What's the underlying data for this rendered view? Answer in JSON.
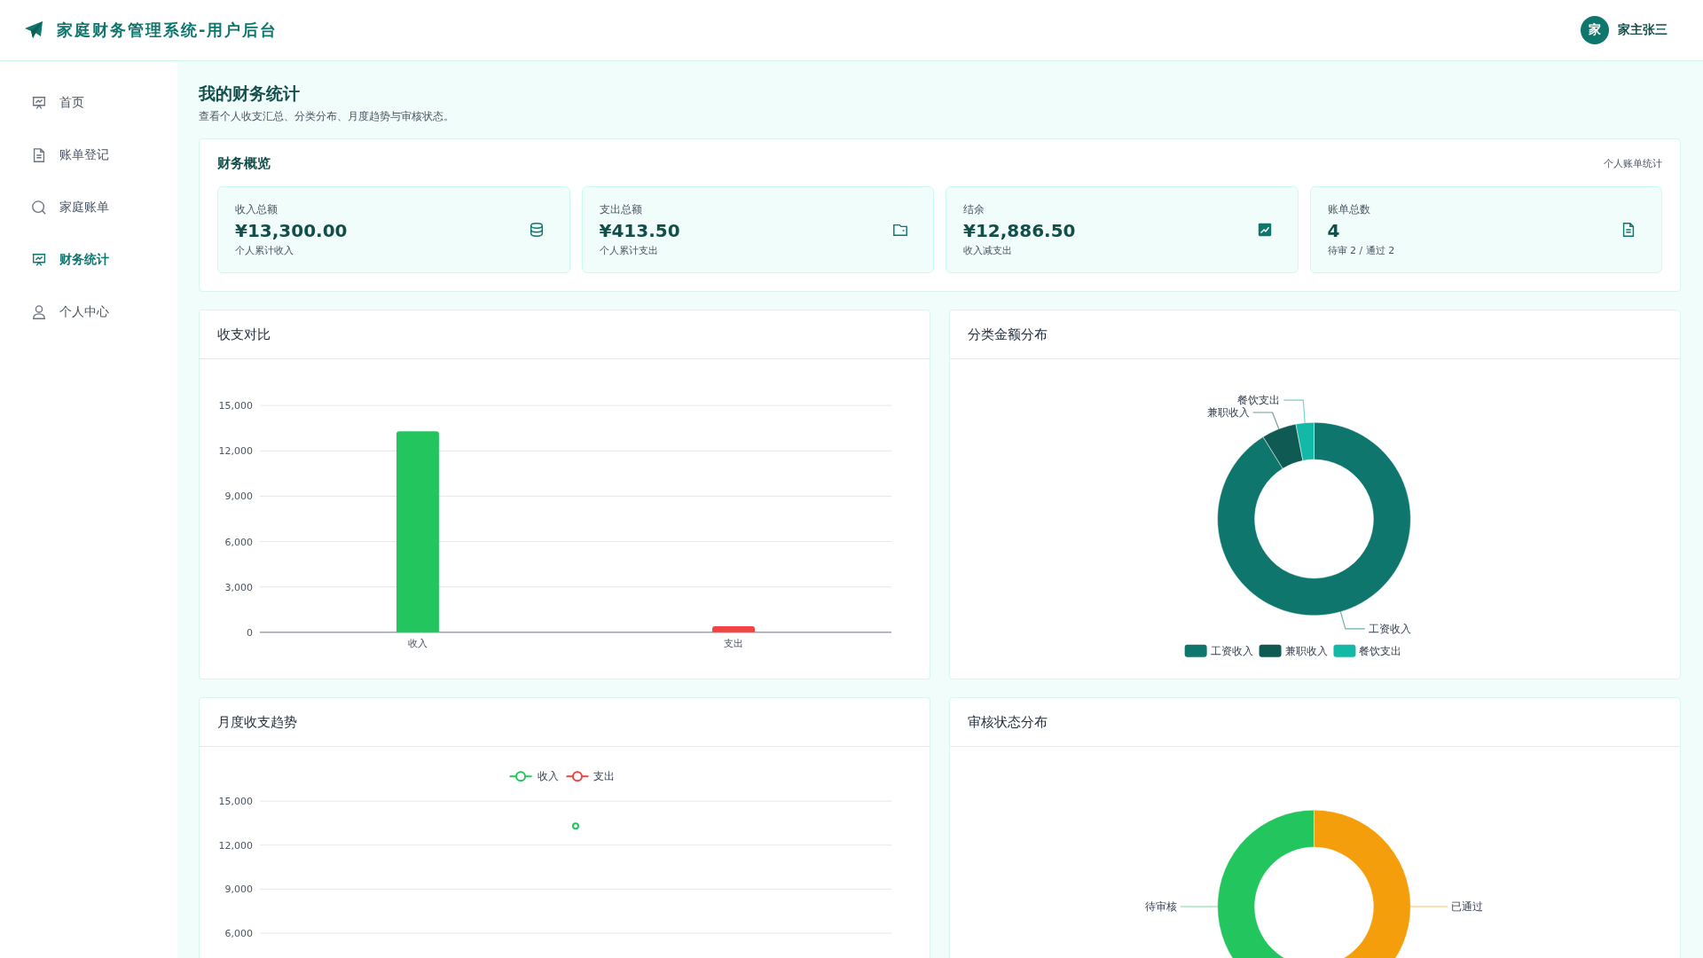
{
  "header": {
    "title": "家庭财务管理系统-用户后台",
    "user": {
      "avatar_text": "家",
      "name": "家主张三"
    }
  },
  "sidebar": {
    "items": [
      {
        "label": "首页",
        "kind": "board",
        "selected": false
      },
      {
        "label": "账单登记",
        "kind": "document",
        "selected": false
      },
      {
        "label": "家庭账单",
        "kind": "search",
        "selected": false
      },
      {
        "label": "财务统计",
        "kind": "board",
        "selected": true
      },
      {
        "label": "个人中心",
        "kind": "user",
        "selected": false
      }
    ]
  },
  "page": {
    "title": "我的财务统计",
    "subtitle": "查看个人收支汇总、分类分布、月度趋势与审核状态。"
  },
  "overview": {
    "title": "财务概览",
    "note": "个人账单统计",
    "cards": [
      {
        "label": "收入总额",
        "value": "¥13,300.00",
        "note": "个人累计收入",
        "kind": "coins"
      },
      {
        "label": "支出总额",
        "value": "¥413.50",
        "note": "个人累计支出",
        "kind": "wallet"
      },
      {
        "label": "结余",
        "value": "¥12,886.50",
        "note": "收入减支出",
        "kind": "chart"
      },
      {
        "label": "账单总数",
        "value": "4",
        "note": "待审 2 / 通过 2",
        "kind": "document"
      }
    ]
  },
  "panels": [
    {
      "title": "收支对比",
      "chart_data": {
        "type": "bar",
        "categories": [
          "收入",
          "支出"
        ],
        "values": [
          13300,
          400
        ],
        "colors": [
          "#22c55e",
          "#ef4444"
        ],
        "grid": true,
        "ylim": [
          0,
          15000
        ],
        "yticks": [
          {
            "value": 0,
            "label": "0"
          },
          {
            "value": 3000,
            "label": "3,000"
          },
          {
            "value": 6000,
            "label": "6,000"
          },
          {
            "value": 9000,
            "label": "9,000"
          },
          {
            "value": 12000,
            "label": "12,000"
          },
          {
            "value": 15000,
            "label": "15,000"
          }
        ]
      }
    },
    {
      "title": "分类金额分布",
      "chart_data": {
        "type": "donut",
        "categories": [
          "工资收入",
          "兼职收入",
          "餐饮支出"
        ],
        "values": [
          91.15,
          5.83,
          3.02
        ],
        "colors": [
          "#0f766e",
          "#0f5a52",
          "#14b8a6"
        ],
        "legend": true
      }
    },
    {
      "title": "月度收支趋势",
      "chart_data": {
        "type": "line",
        "series": [
          {
            "name": "收入",
            "color": "#22c55e",
            "marker": true,
            "values": [
              13300
            ]
          },
          {
            "name": "支出",
            "color": "#ef4444",
            "marker": true,
            "values": [
              null
            ]
          }
        ],
        "grid": true,
        "ylim": [
          6000,
          15000
        ],
        "yticks": [
          {
            "value": 6000,
            "label": "6,000"
          },
          {
            "value": 9000,
            "label": "9,000"
          },
          {
            "value": 12000,
            "label": "12,000"
          },
          {
            "value": 15000,
            "label": "15,000"
          }
        ]
      }
    },
    {
      "title": "审核状态分布",
      "chart_data": {
        "type": "donut",
        "categories": [
          "已通过",
          "待审核"
        ],
        "values": [
          50,
          50
        ],
        "colors": [
          "#f59e0b",
          "#22c55e"
        ],
        "legend": false
      }
    }
  ]
}
